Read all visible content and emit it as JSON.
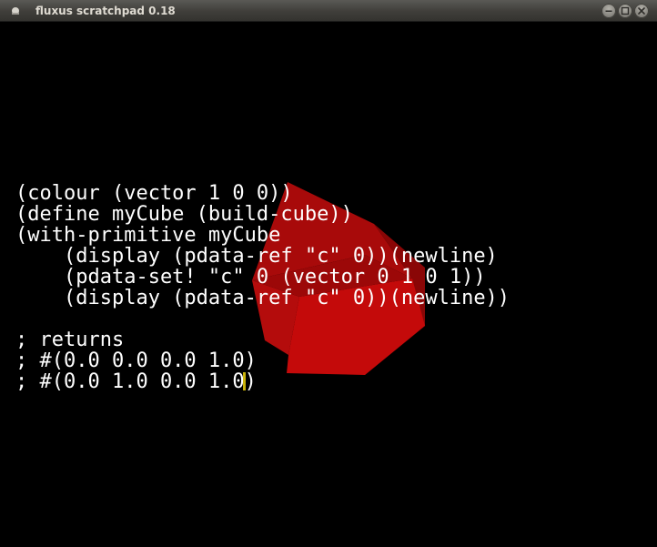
{
  "window": {
    "title": "fluxus scratchpad 0.18",
    "icon": "app-menu-icon",
    "buttons": [
      "minimize-icon",
      "maximize-icon",
      "close-icon"
    ]
  },
  "editor": {
    "background_color": "#000000",
    "text_color": "#ffffff",
    "cursor_color": "#c9b20a",
    "lines": [
      "(colour (vector 1 0 0))",
      "(define myCube (build-cube))",
      "(with-primitive myCube",
      "    (display (pdata-ref \"c\" 0))(newline)",
      "    (pdata-set! \"c\" 0 (vector 0 1 0 1))",
      "    (display (pdata-ref \"c\" 0))(newline))",
      "",
      "; returns",
      "; #(0.0 0.0 0.0 1.0)"
    ],
    "cursor_line": {
      "before": "; #(0.0 1.0 0.0 1.0",
      "after": ")"
    }
  },
  "scene": {
    "object": "cube",
    "color": "#c40a0a"
  }
}
